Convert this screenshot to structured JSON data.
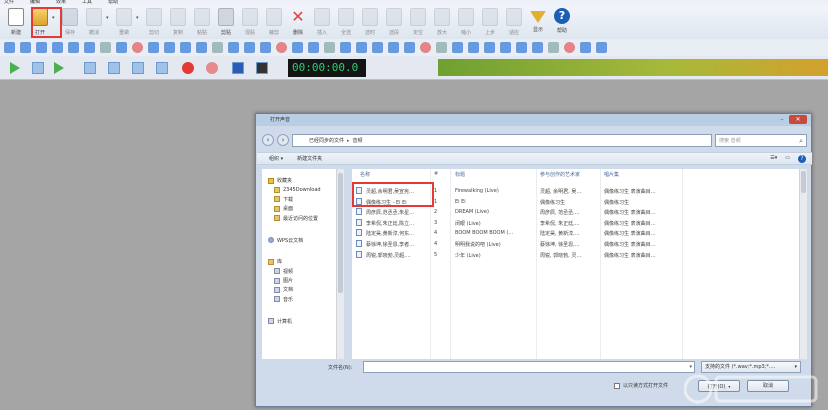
{
  "menu": [
    "文件",
    "编辑",
    "效果",
    "工具",
    "帮助"
  ],
  "toolbar": {
    "buttons": [
      {
        "id": "new",
        "label": "新建",
        "icon": "new-file-icon",
        "dim": false
      },
      {
        "id": "open",
        "label": "打开",
        "icon": "folder-open-icon",
        "dim": false
      },
      {
        "id": "save",
        "label": "保存",
        "icon": "save-icon",
        "dim": true
      },
      {
        "id": "undo",
        "label": "撤消",
        "icon": "undo-icon",
        "dim": true
      },
      {
        "id": "redo",
        "label": "重做",
        "icon": "redo-icon",
        "dim": true
      },
      {
        "id": "cut",
        "label": "剪切",
        "icon": "cut-icon",
        "dim": true
      },
      {
        "id": "copy",
        "label": "复制",
        "icon": "copy-icon",
        "dim": true
      },
      {
        "id": "paste",
        "label": "粘贴",
        "icon": "paste-icon",
        "dim": true
      },
      {
        "id": "clipboard",
        "label": "剪贴",
        "icon": "clipboard-icon",
        "dim": false
      },
      {
        "id": "mix",
        "label": "混贴",
        "icon": "mix-paste-icon",
        "dim": true
      },
      {
        "id": "crop",
        "label": "裁剪",
        "icon": "crop-icon",
        "dim": true
      },
      {
        "id": "delete",
        "label": "删除",
        "icon": "delete-icon",
        "dim": false
      },
      {
        "id": "insert",
        "label": "插入",
        "icon": "insert-icon",
        "dim": true
      },
      {
        "id": "selall",
        "label": "全选",
        "icon": "select-all-icon",
        "dim": true
      },
      {
        "id": "seltime",
        "label": "选时",
        "icon": "select-time-icon",
        "dim": true
      },
      {
        "id": "seldur",
        "label": "选段",
        "icon": "select-range-icon",
        "dim": true
      },
      {
        "id": "cursor",
        "label": "定位",
        "icon": "cursor-icon",
        "dim": true
      },
      {
        "id": "zoomin",
        "label": "放大",
        "icon": "zoom-in-icon",
        "dim": true
      },
      {
        "id": "zoomout",
        "label": "缩小",
        "icon": "zoom-out-icon",
        "dim": true
      },
      {
        "id": "zoomprev",
        "label": "上步",
        "icon": "zoom-prev-icon",
        "dim": true
      },
      {
        "id": "zoomfit",
        "label": "适应",
        "icon": "zoom-fit-icon",
        "dim": true
      },
      {
        "id": "show",
        "label": "显示",
        "icon": "display-icon",
        "dim": false
      },
      {
        "id": "help",
        "label": "帮助",
        "icon": "help-icon",
        "dim": false
      }
    ]
  },
  "transport": {
    "time": "00:00:00.0"
  },
  "dialog": {
    "title": "打开声音",
    "address": [
      "已经同步的文件",
      "音频"
    ],
    "search_placeholder": "搜索 音频",
    "organize": "组织 ▾",
    "new_folder": "新建文件夹",
    "nav": [
      {
        "label": "收藏夹",
        "type": "head",
        "icon": "star"
      },
      {
        "label": "2345Download",
        "type": "item",
        "icon": "fold"
      },
      {
        "label": "下载",
        "type": "item",
        "icon": "fold"
      },
      {
        "label": "桌面",
        "type": "item",
        "icon": "fold"
      },
      {
        "label": "最近访问的位置",
        "type": "item",
        "icon": "fold"
      },
      {
        "label": "",
        "type": "gap",
        "icon": ""
      },
      {
        "label": "WPS云文档",
        "type": "head",
        "icon": "net"
      },
      {
        "label": "",
        "type": "gap",
        "icon": ""
      },
      {
        "label": "库",
        "type": "head",
        "icon": "fold"
      },
      {
        "label": "视频",
        "type": "item",
        "icon": "lib"
      },
      {
        "label": "图片",
        "type": "item",
        "icon": "lib"
      },
      {
        "label": "文档",
        "type": "item",
        "icon": "lib"
      },
      {
        "label": "音乐",
        "type": "item",
        "icon": "lib"
      },
      {
        "label": "",
        "type": "gap",
        "icon": ""
      },
      {
        "label": "计算机",
        "type": "head",
        "icon": "lib"
      }
    ],
    "columns": [
      "名称",
      "#",
      "标题",
      "参与创作的艺术家",
      "唱片集"
    ],
    "files": [
      {
        "name": "灵超,余明君,吴宣宪…",
        "num": "1",
        "title": "Firewalking (Live)",
        "artist": "灵超, 余明君, 吴…",
        "album": "偶像练习生 表演曲目…"
      },
      {
        "name": "偶像练习生 - Ei Ei",
        "num": "1",
        "title": "Ei Ei",
        "artist": "偶像练习生",
        "album": "偶像练习生"
      },
      {
        "name": "周彦辰,范丞丞,朱星…",
        "num": "2",
        "title": "DREAM (Live)",
        "artist": "周彦辰, 范丞丞,…",
        "album": "偶像练习生 表演曲目…"
      },
      {
        "name": "李希侃,朱正廷,陈立…",
        "num": "3",
        "title": "闭眼 (Live)",
        "artist": "李希侃, 朱正廷,…",
        "album": "偶像练习生 表演曲目…"
      },
      {
        "name": "陆定昊,黄新淳,何东…",
        "num": "4",
        "title": "BOOM BOOM BOOM (…",
        "artist": "陆定昊, 黄新淳,…",
        "album": "偶像练习生 表演曲目…"
      },
      {
        "name": "蔡徐坤,徐圣恩,李者…",
        "num": "4",
        "title": "明明我说的吧 (Live)",
        "artist": "蔡徐坤, 徐圣恩,…",
        "album": "偶像练习生 表演曲目…"
      },
      {
        "name": "周锐,郭晓勃,灵超,…",
        "num": "5",
        "title": "少年 (Live)",
        "artist": "周锐, 郭晓勃, 灵…",
        "album": "偶像练习生 表演曲目…"
      }
    ],
    "filename_label": "文件名(N):",
    "filetype": "支持的文件 (*.wav;*.mp3;*.…",
    "readonly_label": "以只读方式打开文件",
    "open_button": "打开(O)",
    "cancel_button": "取消"
  }
}
